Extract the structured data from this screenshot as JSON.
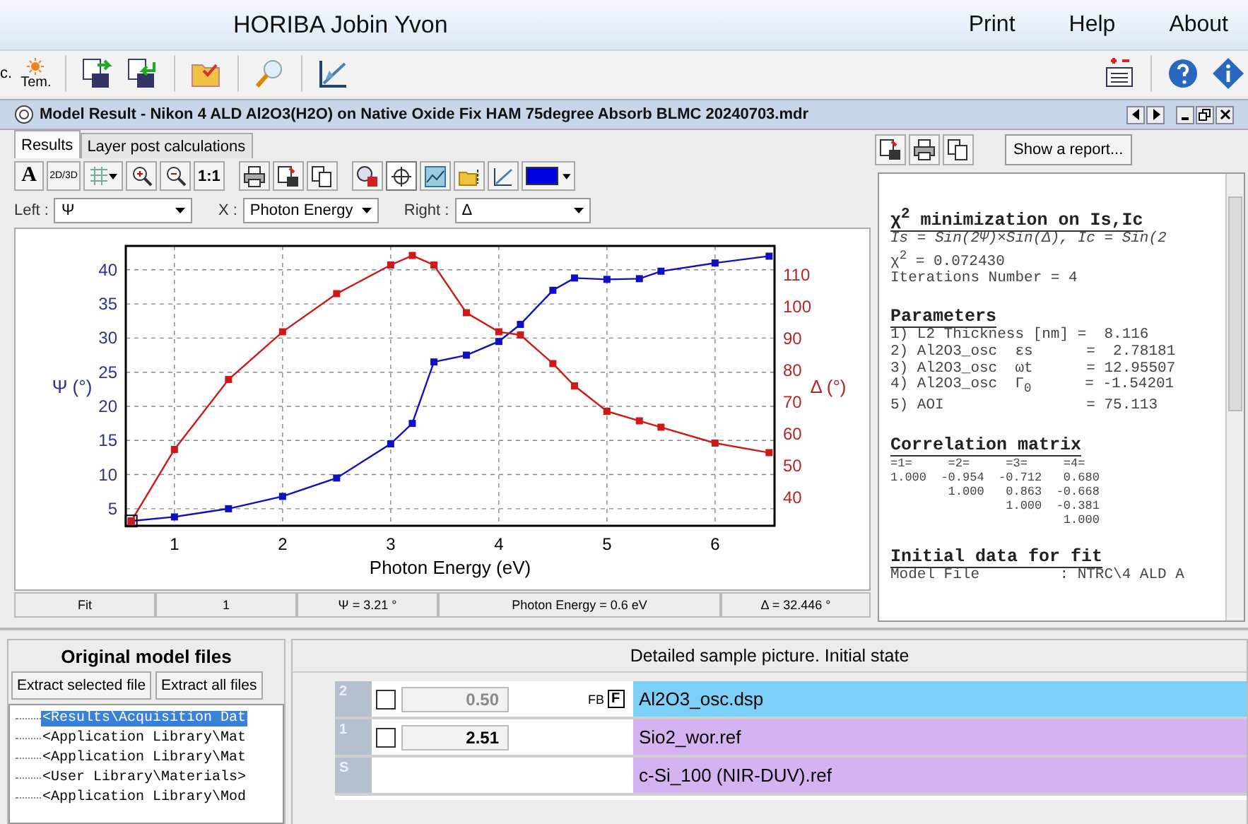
{
  "app_bar": {
    "title": "HORIBA Jobin Yvon",
    "menu": [
      "Print",
      "Help",
      "About"
    ]
  },
  "toolbar": {
    "cut_label": "c.",
    "tem_label": "Tem."
  },
  "window": {
    "title": "Model Result - Nikon 4 ALD Al2O3(H2O) on Native Oxide Fix HAM 75degree Absorb BLMC 20240703.mdr"
  },
  "tabs": [
    {
      "label": "Results",
      "selected": true
    },
    {
      "label": "Layer post calculations",
      "selected": false
    }
  ],
  "chart_toolbar": {
    "text_buttons": [
      "A",
      "2D/3D",
      "1:1"
    ]
  },
  "axis_selectors": [
    {
      "label": "Left :",
      "value": "Ψ"
    },
    {
      "label": "X :",
      "value": "Photon Energy"
    },
    {
      "label": "Right :",
      "value": "Δ"
    }
  ],
  "chart": {
    "chart_data": {
      "type": "line",
      "xlabel": "Photon Energy (eV)",
      "ylabel": "Ψ (°)",
      "y2label": "Δ (°)",
      "x": [
        0.6,
        1,
        1.5,
        2,
        2.5,
        3,
        3.2,
        3.4,
        3.7,
        4,
        4.2,
        4.5,
        4.7,
        5,
        5.3,
        5.5,
        6,
        6.5
      ],
      "series": [
        {
          "color": "#1010c0",
          "marker": "square",
          "values": [
            3.2,
            3.8,
            5,
            6.8,
            9.5,
            14.5,
            17.5,
            26.5,
            27.5,
            29.5,
            32,
            37,
            38.8,
            38.6,
            38.7,
            39.8,
            41,
            42
          ]
        },
        {
          "color": "#d01818",
          "marker": "square",
          "axis": "y2",
          "values": [
            32.4,
            55,
            77,
            92,
            104,
            113,
            116,
            113,
            98,
            92,
            91,
            82,
            75,
            67,
            64,
            62,
            57,
            54
          ]
        }
      ],
      "grid": true,
      "xlim": [
        0.55,
        6.55
      ],
      "ylim": [
        2.5,
        43.5
      ],
      "y2lim": [
        31,
        119
      ],
      "xticks": [
        1,
        2,
        3,
        4,
        5,
        6
      ],
      "yticks": [
        5,
        10,
        15,
        20,
        25,
        30,
        35,
        40
      ],
      "y2ticks": [
        40,
        50,
        60,
        70,
        80,
        90,
        100,
        110
      ]
    }
  },
  "status_row": [
    "Fit",
    "1",
    "Ψ = 3.21 °",
    "Photon Energy = 0.6 eV",
    "Δ = 32.446 °"
  ],
  "report_button": "Show a report...",
  "report": [
    {
      "kind": "heading",
      "text": "χ$^{2}$ minimization on Is,Ic"
    },
    {
      "kind": "italic",
      "text": "Is = Sin(2Ψ)×Sin(Δ), Ic = Sin(2"
    },
    {
      "kind": "line",
      "text": "χ$^{2}$ = 0.072430"
    },
    {
      "kind": "line",
      "text": "Iterations Number = 4"
    },
    {
      "kind": "blank"
    },
    {
      "kind": "heading",
      "text": "Parameters"
    },
    {
      "kind": "line",
      "text": "1) L2 Thickness [nm] =  8.116"
    },
    {
      "kind": "line",
      "text": "2) Al2O3_osc  εs      =  2.78181"
    },
    {
      "kind": "line",
      "text": "3) Al2O3_osc  ωt      = 12.95507"
    },
    {
      "kind": "line",
      "text": "4) Al2O3_osc  Γ$_{0}$      = -1.54201"
    },
    {
      "kind": "line",
      "text": "5) AOI                = 75.113"
    },
    {
      "kind": "blank"
    },
    {
      "kind": "heading",
      "text": "Correlation matrix"
    },
    {
      "kind": "small",
      "text": "=1=     =2=     =3=     =4="
    },
    {
      "kind": "small",
      "text": "1.000  -0.954  -0.712   0.680"
    },
    {
      "kind": "small",
      "text": "        1.000   0.863  -0.668"
    },
    {
      "kind": "small",
      "text": "                1.000  -0.381"
    },
    {
      "kind": "small",
      "text": "                        1.000"
    },
    {
      "kind": "blank"
    },
    {
      "kind": "heading",
      "text": "Initial data for fit"
    },
    {
      "kind": "line",
      "text": "Model File         : NTRC\\4 ALD A"
    }
  ],
  "model_files": {
    "title": "Original model files",
    "buttons": [
      "Extract selected file",
      "Extract all files"
    ],
    "items": [
      {
        "label": "<Results\\Acquisition Dat",
        "selected": true
      },
      {
        "label": "<Application Library\\Mat",
        "selected": false
      },
      {
        "label": "<Application Library\\Mat",
        "selected": false
      },
      {
        "label": "<User Library\\Materials>",
        "selected": false
      },
      {
        "label": "<Application Library\\Mod",
        "selected": false
      }
    ]
  },
  "sample": {
    "title": "Detailed sample picture. Initial state",
    "layers": [
      {
        "number": "2",
        "checked": false,
        "value": "0.50",
        "disabled": true,
        "fb": "FB",
        "flag": "F",
        "label": "Al2O3_osc.dsp",
        "color": "#7ccff6"
      },
      {
        "number": "1",
        "checked": false,
        "value": "2.51",
        "disabled": false,
        "label": "Sio2_wor.ref",
        "color": "#d5b3f2"
      },
      {
        "number": "S",
        "label": "c-Si_100 (NIR-DUV).ref",
        "color": "#d5b3f2"
      }
    ]
  }
}
